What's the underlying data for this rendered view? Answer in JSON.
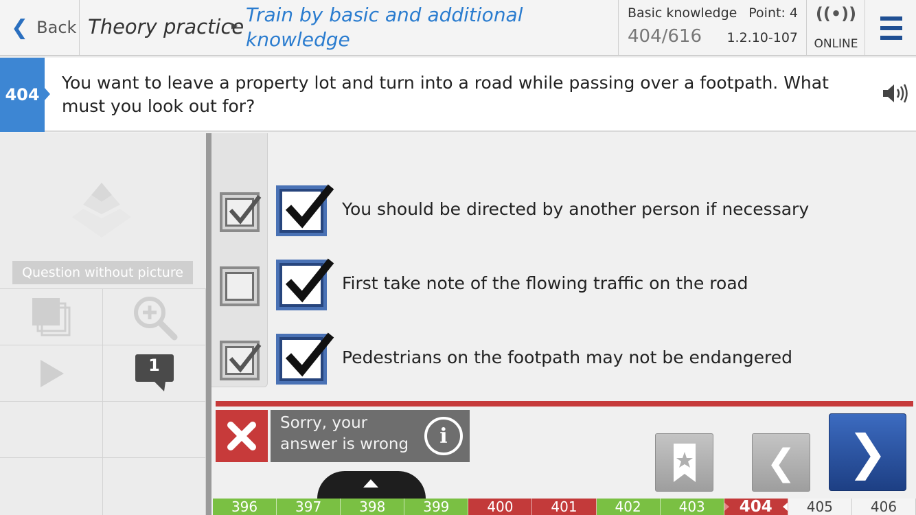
{
  "header": {
    "back_label": "Back",
    "breadcrumb": "Theory practice",
    "mode_title": "Train by basic and additional knowledge",
    "category": "Basic knowledge",
    "points": "Point: 4",
    "progress": "404/616",
    "version": "1.2.10-107",
    "online_label": "ONLINE",
    "online_icon": "broadcast-icon",
    "menu_icon": "hamburger-icon"
  },
  "question": {
    "number": "404",
    "text": "You want to leave a property lot and turn into a road while passing over a footpath. What must you look out for?",
    "audio_icon": "speaker-icon"
  },
  "left_panel": {
    "picture_label": "Question without picture",
    "comment_count": "1"
  },
  "answers": [
    {
      "text": "You should be directed by another person if necessary",
      "user_checked": true,
      "correct": true
    },
    {
      "text": "First take note of the flowing traffic on the road",
      "user_checked": false,
      "correct": true
    },
    {
      "text": "Pedestrians on the footpath may not be endangered",
      "user_checked": true,
      "correct": true
    }
  ],
  "result": {
    "message": "Sorry, your answer is wrong",
    "status": "wrong"
  },
  "colors": {
    "accent_blue": "#3d86d3",
    "wrong_red": "#c33a3a",
    "correct_green": "#7ac043",
    "next_button": "#1f4590"
  },
  "question_strip": [
    {
      "num": "396",
      "state": "correct"
    },
    {
      "num": "397",
      "state": "correct"
    },
    {
      "num": "398",
      "state": "correct"
    },
    {
      "num": "399",
      "state": "correct"
    },
    {
      "num": "400",
      "state": "wrong"
    },
    {
      "num": "401",
      "state": "wrong"
    },
    {
      "num": "402",
      "state": "correct"
    },
    {
      "num": "403",
      "state": "correct"
    },
    {
      "num": "404",
      "state": "current"
    },
    {
      "num": "405",
      "state": "unanswered"
    },
    {
      "num": "406",
      "state": "unanswered"
    }
  ]
}
